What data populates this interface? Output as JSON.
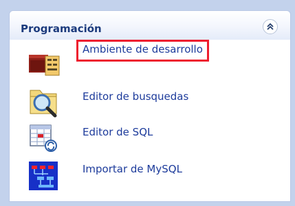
{
  "panel": {
    "title": "Programación",
    "collapse_glyph": "⌃",
    "items": [
      {
        "label": "Ambiente de desarrollo",
        "icon": "folder-cabinet-icon",
        "selected": true
      },
      {
        "label": "Editor de busquedas",
        "icon": "magnifier-folder-icon",
        "selected": false
      },
      {
        "label": "Editor de SQL",
        "icon": "sql-table-icon",
        "selected": false
      },
      {
        "label": "Importar de MySQL",
        "icon": "import-diagram-icon",
        "selected": false
      }
    ]
  },
  "colors": {
    "selection_border": "#ee1c2e",
    "title": "#1c3b7d",
    "link": "#1d3b9b",
    "background": "#c3d2ec"
  }
}
